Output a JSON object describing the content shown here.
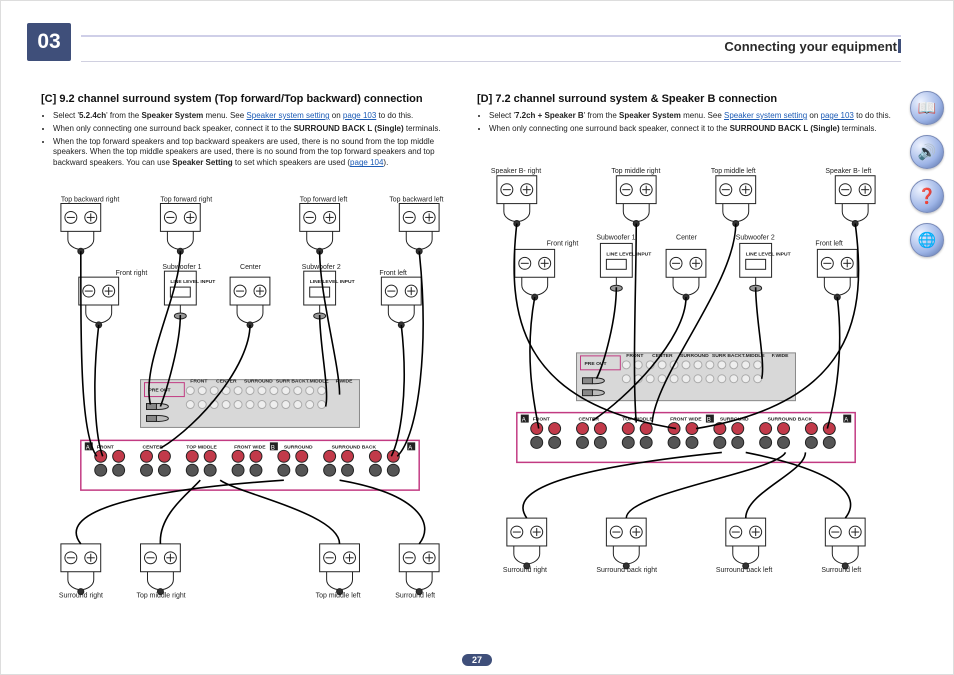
{
  "chapter_number": "03",
  "header_title": "Connecting your equipment",
  "page_number": "27",
  "left": {
    "title": "[C] 9.2 channel surround system (Top forward/Top backward) connection",
    "bullets": [
      {
        "pre": "Select '",
        "bold1": "5.2.4ch",
        "mid1": "' from the ",
        "bold2": "Speaker System",
        "mid2": " menu.\nSee ",
        "link": "Speaker system setting",
        "post": " on ",
        "link2": "page 103",
        "tail": " to do this."
      },
      {
        "text_pre": "When only connecting one surround back speaker, connect it to the ",
        "bold": "SURROUND BACK L (Single)",
        "text_post": " terminals."
      },
      {
        "text_pre": "When the top forward speakers and top backward speakers are used, there is no sound from the top middle speakers. When the top middle speakers are used, there is no sound from the top forward speakers and top backward speakers. You can use ",
        "bold": "Speaker Setting",
        "text_post": " to set which speakers are used (",
        "link": "page 104",
        "tail": ")."
      }
    ],
    "labels": {
      "topBackRight": "Top backward right",
      "topFwdRight": "Top forward right",
      "topFwdLeft": "Top forward left",
      "topBackLeft": "Top backward left",
      "frontRight": "Front right",
      "sub1": "Subwoofer 1",
      "center": "Center",
      "sub2": "Subwoofer 2",
      "frontLeft": "Front left",
      "surroundRight": "Surround right",
      "topMidRight": "Top middle right",
      "topMidLeft": "Top middle left",
      "surroundLeft": "Surround left"
    },
    "amp": {
      "preout": "PRE OUT",
      "front": "FRONT",
      "center": "CENTER",
      "surround": "SURROUND",
      "surrB": "SURR BACK",
      "tmiddle": "T.MIDDLE",
      "fwide": "F.WIDE",
      "frontA": "FRONT",
      "centerA": "CENTER",
      "topmid": "TOP MIDDLE",
      "fwideA": "FRONT WIDE",
      "surroundA": "SURROUND",
      "surrBackA": "SURROUND BACK",
      "llinput": "LINE LEVEL\nINPUT"
    }
  },
  "right": {
    "title": "[D] 7.2 channel surround system & Speaker B connection",
    "bullets": [
      {
        "pre": "Select '",
        "bold1": "7.2ch + Speaker B",
        "mid1": "' from the ",
        "bold2": "Speaker System",
        "mid2": " menu.\nSee ",
        "link": "Speaker system setting",
        "post": " on ",
        "link2": "page 103",
        "tail": " to do this."
      },
      {
        "text_pre": "When only connecting one surround back speaker, connect it to the ",
        "bold": "SURROUND BACK L (Single)",
        "text_post": " terminals."
      }
    ],
    "labels": {
      "spkBRight": "Speaker B- right",
      "topMidRight": "Top middle right",
      "topMidLeft": "Top middle left",
      "spkBLeft": "Speaker B- left",
      "frontRight": "Front right",
      "sub1": "Subwoofer 1",
      "center": "Center",
      "sub2": "Subwoofer 2",
      "frontLeft": "Front left",
      "surroundRight": "Surround right",
      "surrBackRight": "Surround back right",
      "surrBackLeft": "Surround back left",
      "surroundLeft": "Surround left"
    },
    "amp": {
      "preout": "PRE OUT",
      "frontA": "FRONT",
      "centerA": "CENTER",
      "topmid": "TOP MIDDLE",
      "fwideA": "FRONT WIDE",
      "surroundA": "SURROUND",
      "surrBackA": "SURROUND BACK",
      "llinput": "LINE LEVEL\nINPUT",
      "front": "FRONT",
      "center": "CENTER",
      "surround": "SURROUND",
      "surrB": "SURR BACK",
      "tmiddle": "T.MIDDLE",
      "fwide": "F.WIDE"
    }
  },
  "sidebar": {
    "book": "📖",
    "speaker": "🔊",
    "help": "❓",
    "globe": "🌐"
  }
}
